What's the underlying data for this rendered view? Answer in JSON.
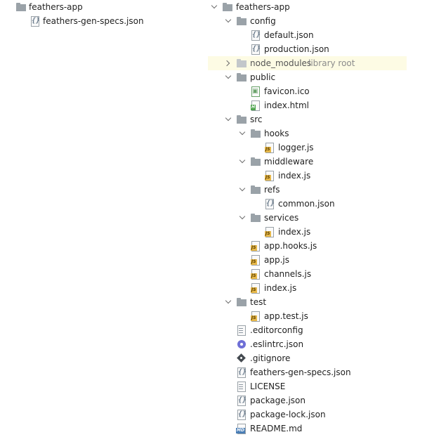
{
  "left_tree": {
    "root_label": "feathers-app",
    "children": [
      {
        "label": "feathers-gen-specs.json",
        "icon": "json-file-icon"
      }
    ]
  },
  "right_tree": {
    "root_label": "feathers-app",
    "config": {
      "label": "config",
      "children": [
        {
          "label": "default.json",
          "icon": "json-file-icon"
        },
        {
          "label": "production.json",
          "icon": "json-file-icon"
        }
      ]
    },
    "node_modules": {
      "label": "node_modules",
      "hint": "library root"
    },
    "public": {
      "label": "public",
      "children": [
        {
          "label": "favicon.ico",
          "icon": "image-file-icon"
        },
        {
          "label": "index.html",
          "icon": "html-file-icon"
        }
      ]
    },
    "src": {
      "label": "src",
      "hooks": {
        "label": "hooks",
        "children": [
          {
            "label": "logger.js",
            "icon": "js-file-icon"
          }
        ]
      },
      "middleware": {
        "label": "middleware",
        "children": [
          {
            "label": "index.js",
            "icon": "js-file-icon"
          }
        ]
      },
      "refs": {
        "label": "refs",
        "children": [
          {
            "label": "common.json",
            "icon": "json-file-icon"
          }
        ]
      },
      "services": {
        "label": "services",
        "children": [
          {
            "label": "index.js",
            "icon": "js-file-icon"
          }
        ]
      },
      "files": [
        {
          "label": "app.hooks.js",
          "icon": "js-file-icon"
        },
        {
          "label": "app.js",
          "icon": "js-file-icon"
        },
        {
          "label": "channels.js",
          "icon": "js-file-icon"
        },
        {
          "label": "index.js",
          "icon": "js-file-icon"
        }
      ]
    },
    "test": {
      "label": "test",
      "children": [
        {
          "label": "app.test.js",
          "icon": "js-file-icon"
        }
      ]
    },
    "root_files": [
      {
        "label": ".editorconfig",
        "icon": "config-file-icon"
      },
      {
        "label": ".eslintrc.json",
        "icon": "eslint-file-icon"
      },
      {
        "label": ".gitignore",
        "icon": "git-file-icon"
      },
      {
        "label": "feathers-gen-specs.json",
        "icon": "json-file-icon"
      },
      {
        "label": "LICENSE",
        "icon": "text-file-icon"
      },
      {
        "label": "package.json",
        "icon": "json-file-icon"
      },
      {
        "label": "package-lock.json",
        "icon": "json-file-icon"
      },
      {
        "label": "README.md",
        "icon": "markdown-file-icon"
      }
    ]
  },
  "colors": {
    "folder": "#9aa2a8",
    "highlight": "#fdfbe4",
    "hint": "#8c8c8c",
    "js_badge": "#e8b94a"
  }
}
